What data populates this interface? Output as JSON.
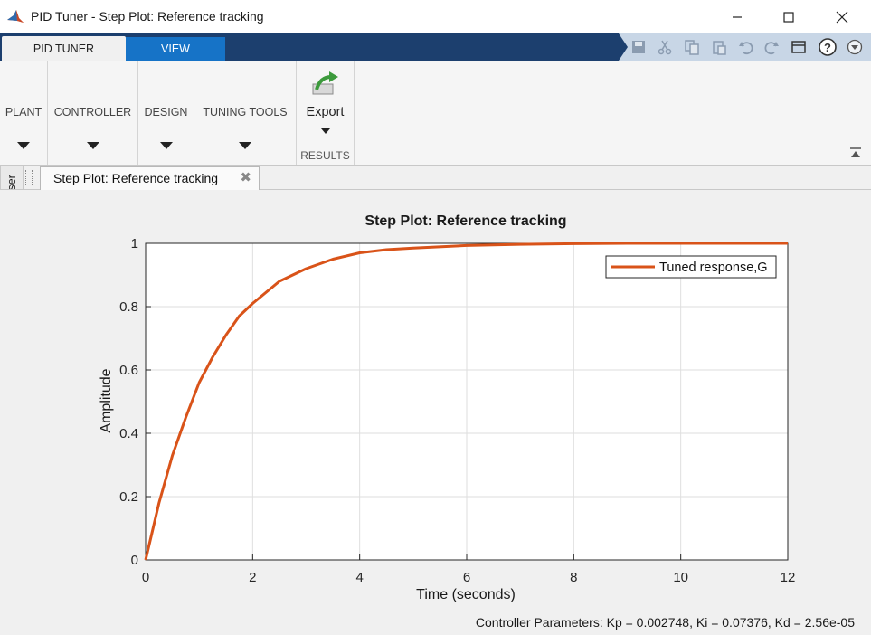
{
  "window": {
    "title": "PID Tuner - Step Plot: Reference tracking",
    "buttons": [
      "minimize",
      "maximize",
      "close"
    ]
  },
  "tabs": {
    "active": "PID TUNER",
    "other": "VIEW"
  },
  "ribbon": {
    "groups": [
      {
        "label": "PLANT"
      },
      {
        "label": "CONTROLLER"
      },
      {
        "label": "DESIGN"
      },
      {
        "label": "TUNING TOOLS"
      }
    ],
    "export_label": "Export",
    "results_label": "RESULTS"
  },
  "sidebar": {
    "label": "Data Browser"
  },
  "document_tab": {
    "label": "Step Plot: Reference tracking"
  },
  "chart_data": {
    "type": "line",
    "title": "Step Plot: Reference tracking",
    "xlabel": "Time (seconds)",
    "ylabel": "Amplitude",
    "xlim": [
      0,
      12
    ],
    "ylim": [
      0,
      1
    ],
    "xticks": [
      0,
      2,
      4,
      6,
      8,
      10,
      12
    ],
    "yticks": [
      0,
      0.2,
      0.4,
      0.6,
      0.8,
      1
    ],
    "ytick_labels": [
      "0",
      "0.2",
      "0.4",
      "0.6",
      "0.8",
      "1"
    ],
    "grid": true,
    "legend_position": "top-right",
    "series": [
      {
        "name": "Tuned response,G",
        "color": "#d95319",
        "x": [
          0,
          0.25,
          0.5,
          0.75,
          1,
          1.25,
          1.5,
          1.75,
          2,
          2.5,
          3,
          3.5,
          4,
          4.5,
          5,
          6,
          7,
          8,
          9,
          10,
          11,
          12
        ],
        "y": [
          0,
          0.18,
          0.33,
          0.45,
          0.56,
          0.64,
          0.71,
          0.77,
          0.81,
          0.88,
          0.92,
          0.95,
          0.97,
          0.98,
          0.985,
          0.993,
          0.997,
          0.999,
          1.0,
          1.0,
          1.0,
          1.0
        ]
      }
    ]
  },
  "status": {
    "text": "Controller Parameters: Kp = 0.002748, Ki = 0.07376, Kd = 2.56e-05"
  }
}
